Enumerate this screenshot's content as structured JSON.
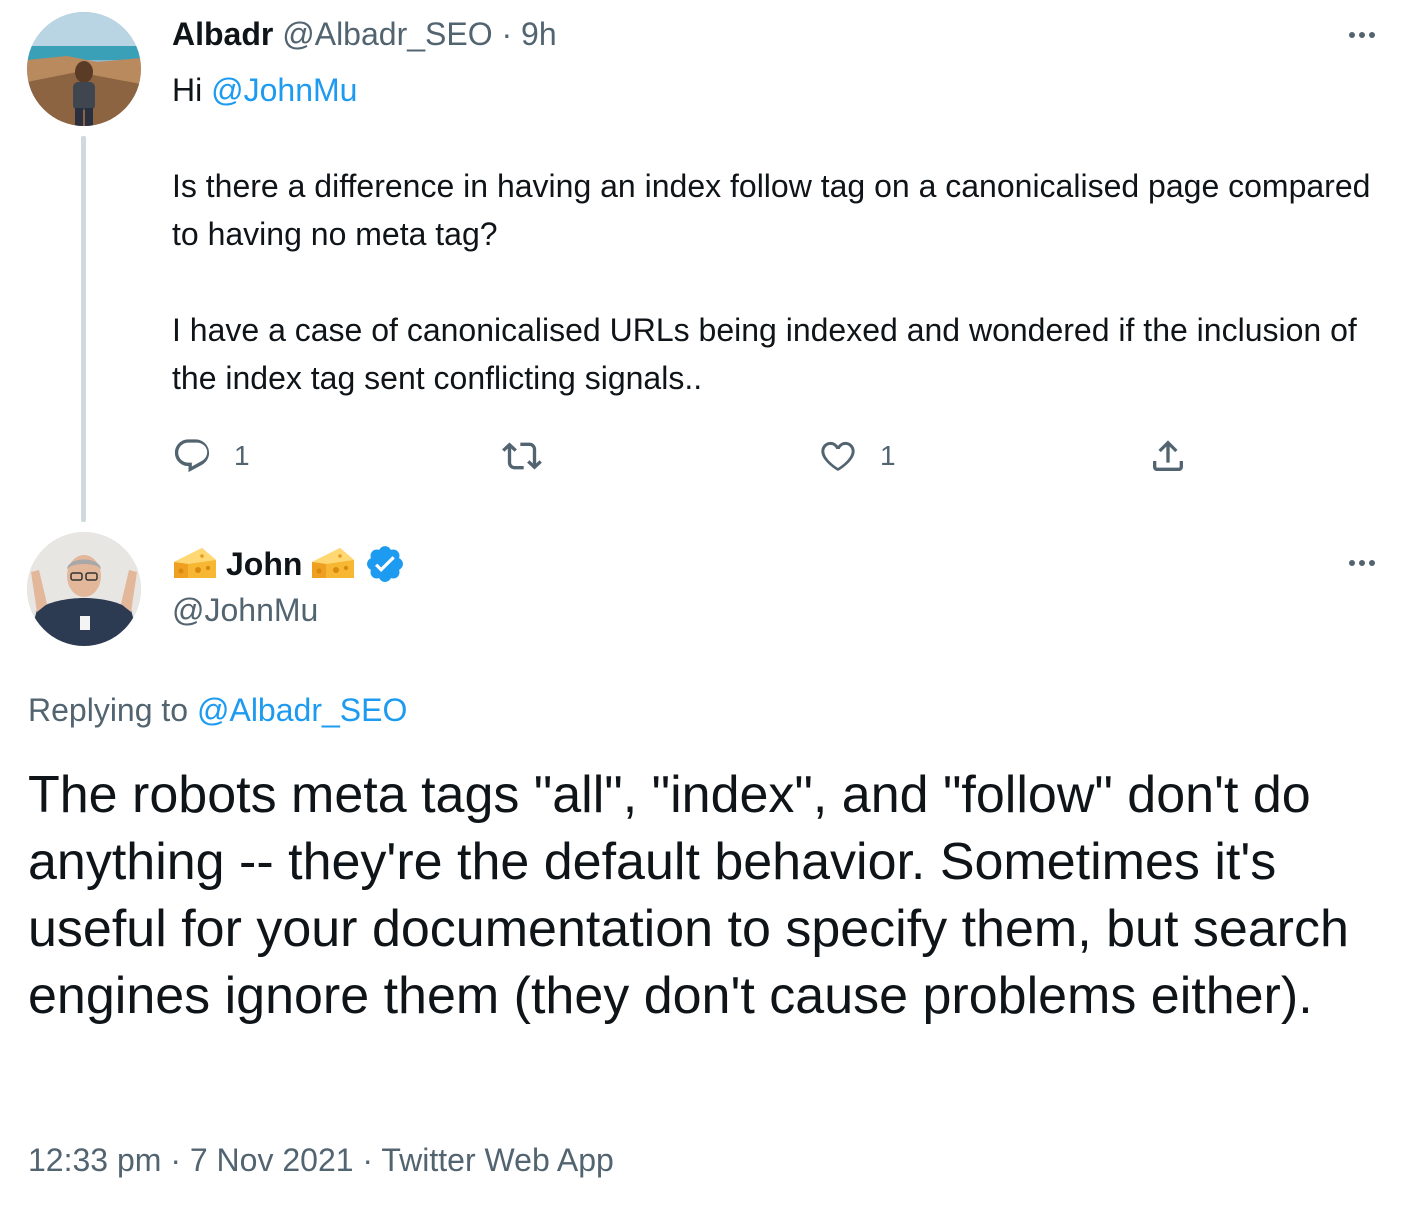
{
  "parent": {
    "name": "Albadr",
    "handle": "@Albadr_SEO",
    "separator": "·",
    "time": "9h",
    "greeting": "Hi",
    "mention": "@JohnMu",
    "paragraph1": "Is there a difference in  having an index follow tag on a canonicalised page compared to having no meta tag?",
    "paragraph2": "I have a case of canonicalised URLs being indexed and wondered if the inclusion of the index tag sent conflicting signals..",
    "reply_count": "1",
    "like_count": "1"
  },
  "reply": {
    "name": "John",
    "handle": "@JohnMu",
    "replying_prefix": "Replying to",
    "replying_handle": "@Albadr_SEO",
    "text": "The robots meta tags \"all\", \"index\", and \"follow\" don't do anything -- they're the default behavior. Sometimes it's useful for your documentation to specify them, but search engines ignore them (they don't cause problems either).",
    "timestamp": "12:33 pm · 7 Nov 2021 · Twitter Web App"
  },
  "icons": {
    "more": "more-horizontal-icon",
    "reply": "reply-icon",
    "retweet": "retweet-icon",
    "like": "heart-icon",
    "share": "share-icon",
    "verified": "verified-badge-icon",
    "emoji": "cheese-emoji-icon"
  },
  "colors": {
    "accent": "#1d9bf0",
    "text": "#0f1419",
    "muted": "#536471",
    "thread_line": "#cfd9de"
  }
}
